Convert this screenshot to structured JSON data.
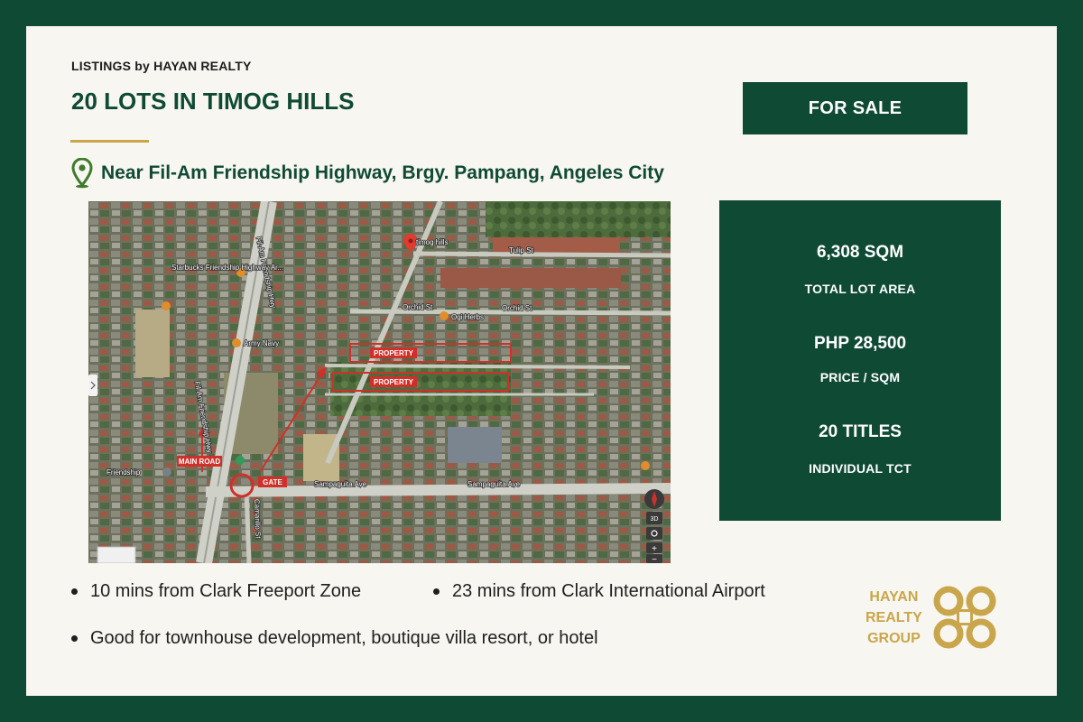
{
  "header": {
    "eyebrow": "LISTINGS by HAYAN REALTY",
    "title": "20 LOTS IN TIMOG HILLS",
    "location": "Near Fil-Am Friendship Highway, Brgy. Pampang, Angeles City",
    "location_icon": "map-pin-icon",
    "sale_label": "FOR SALE"
  },
  "map": {
    "labels": {
      "timog_hills": "timog hills",
      "tulip_st": "Tulip St",
      "orchid_st": "Orchid St",
      "orchid_st_2": "Orchid St",
      "sampaguita_ave": "Sampaguita Ave",
      "sampaguita_ave_2": "Sampaguita Ave",
      "fil_am_hwy": "Fil-Am Friendship Hwy",
      "fil_am_hwy_2": "Fil-Am Friendship Hwy",
      "starbucks": "Starbucks Friendship Highway Ar...",
      "army_navy": "Army Navy",
      "herbs": "Ogi Herbs",
      "friendship": "Friendship",
      "camarillo_st": "Camarillo St"
    },
    "tags": {
      "property_1": "PROPERTY",
      "property_2": "PROPERTY",
      "main_road": "MAIN ROAD",
      "gate": "GATE"
    },
    "controls": {
      "view_3d": "3D",
      "zoom_in": "+",
      "zoom_out": "−"
    }
  },
  "stats": {
    "area_value": "6,308 SQM",
    "area_label": "TOTAL LOT AREA",
    "price_value": "PHP 28,500",
    "price_label": "PRICE / SQM",
    "titles_value": "20 TITLES",
    "titles_label": "INDIVIDUAL TCT"
  },
  "bullets": [
    "10 mins from Clark Freeport Zone",
    "23 mins from Clark International Airport",
    "Good for townhouse development, boutique villa resort, or hotel"
  ],
  "brand": {
    "line1": "HAYAN",
    "line2": "REALTY",
    "line3": "GROUP",
    "logo_icon": "hayan-logo-icon"
  },
  "colors": {
    "brand_green": "#0f4a35",
    "accent_gold": "#c9a64b",
    "card_bg": "#f7f6f0",
    "marker_red": "#d0302a"
  }
}
